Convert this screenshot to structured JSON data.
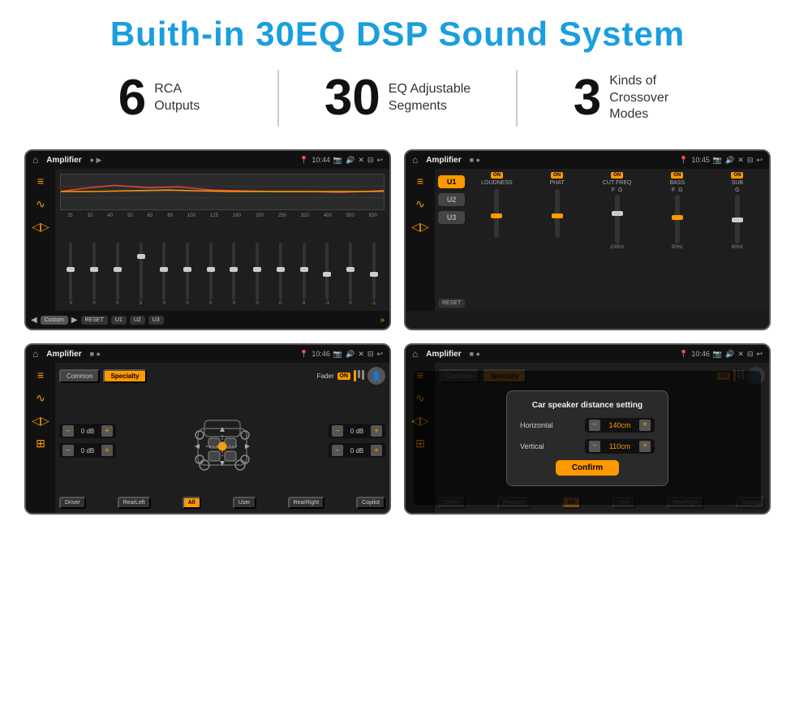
{
  "header": {
    "title": "Buith-in 30EQ DSP Sound System"
  },
  "stats": [
    {
      "number": "6",
      "label_line1": "RCA",
      "label_line2": "Outputs"
    },
    {
      "number": "30",
      "label_line1": "EQ Adjustable",
      "label_line2": "Segments"
    },
    {
      "number": "3",
      "label_line1": "Kinds of",
      "label_line2": "Crossover Modes"
    }
  ],
  "screen1": {
    "title": "Amplifier",
    "time": "10:44",
    "eq_freqs": [
      "25",
      "32",
      "40",
      "50",
      "63",
      "80",
      "100",
      "125",
      "160",
      "200",
      "250",
      "320",
      "400",
      "500",
      "630"
    ],
    "eq_values": [
      "0",
      "0",
      "0",
      "5",
      "0",
      "0",
      "0",
      "0",
      "0",
      "0",
      "0",
      "-1",
      "0",
      "-1"
    ],
    "preset_label": "Custom",
    "buttons": [
      "RESET",
      "U1",
      "U2",
      "U3"
    ]
  },
  "screen2": {
    "title": "Amplifier",
    "time": "10:45",
    "u_buttons": [
      "U1",
      "U2",
      "U3"
    ],
    "controls": [
      "LOUDNESS",
      "PHAT",
      "CUT FREQ",
      "BASS",
      "SUB"
    ],
    "reset_label": "RESET"
  },
  "screen3": {
    "title": "Amplifier",
    "time": "10:46",
    "tabs": [
      "Common",
      "Specialty"
    ],
    "fader_label": "Fader",
    "on_label": "ON",
    "db_values": [
      "0 dB",
      "0 dB",
      "0 dB",
      "0 dB"
    ],
    "bottom_btns": [
      "Driver",
      "All",
      "User",
      "RearRight"
    ],
    "bottom_left": "RearLeft",
    "bottom_right": "Copilot"
  },
  "screen4": {
    "title": "Amplifier",
    "time": "10:46",
    "tabs": [
      "Common",
      "Specialty"
    ],
    "dialog": {
      "title": "Car speaker distance setting",
      "horizontal_label": "Horizontal",
      "horizontal_value": "140cm",
      "vertical_label": "Vertical",
      "vertical_value": "110cm",
      "confirm_label": "Confirm"
    },
    "bottom_btns": [
      "Driver",
      "RearLeft",
      "All",
      "User",
      "RearRight",
      "Copilot"
    ]
  }
}
